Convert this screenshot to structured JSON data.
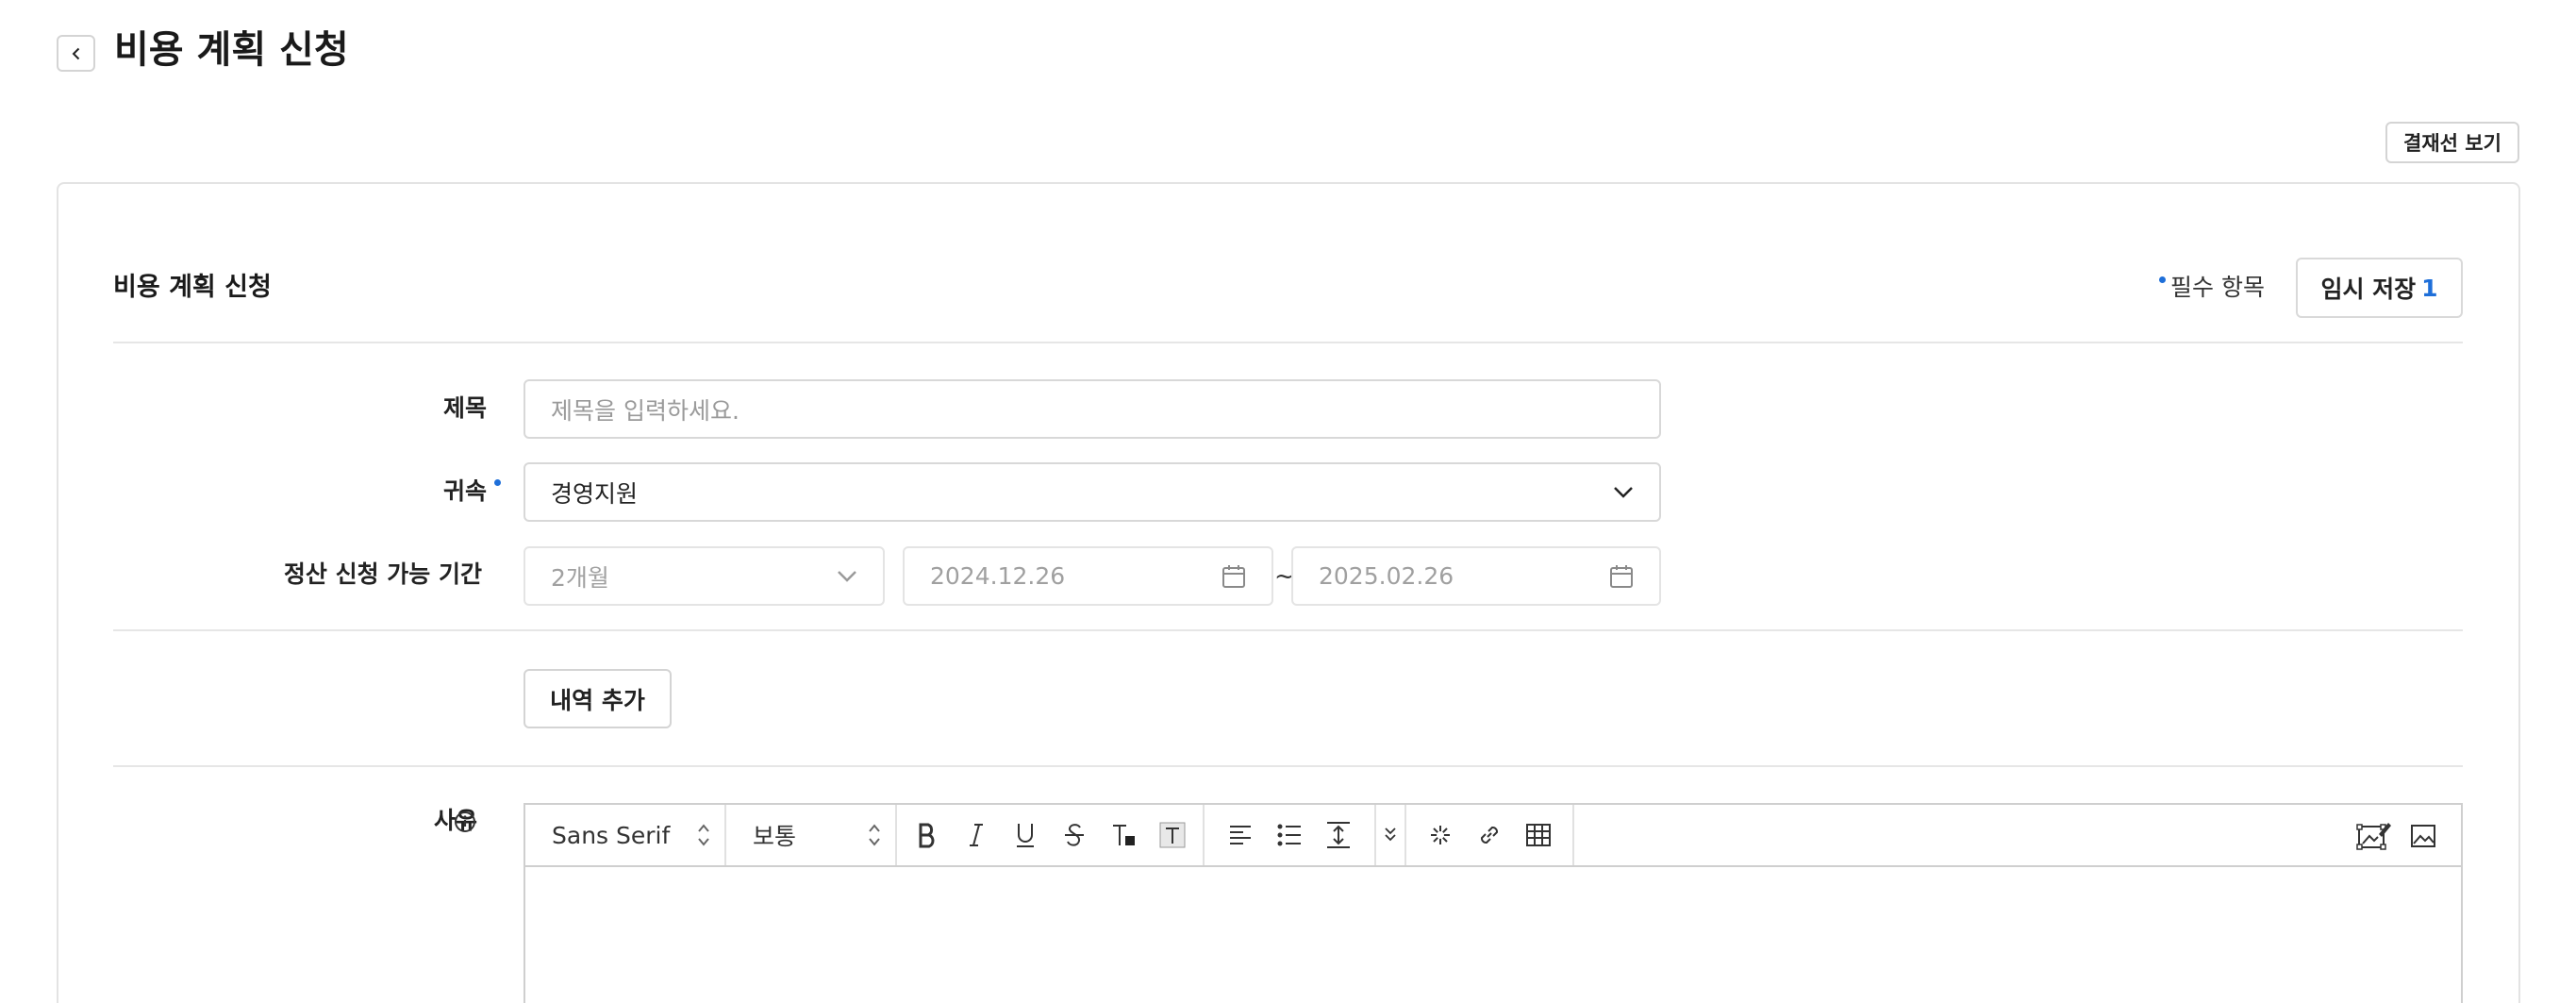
{
  "header": {
    "title": "비용 계획 신청"
  },
  "approval_line_button": "결재선 보기",
  "form": {
    "section_title": "비용 계획 신청",
    "required_note": "필수 항목",
    "save_draft": {
      "label": "임시 저장",
      "count": "1"
    },
    "fields": {
      "title": {
        "label": "제목",
        "placeholder": "제목을 입력하세요."
      },
      "department": {
        "label": "귀속",
        "value": "경영지원"
      },
      "settlement_period": {
        "label": "정산 신청 가능 기간",
        "duration": "2개월",
        "start_date": "2024.12.26",
        "separator": "~",
        "end_date": "2025.02.26"
      }
    },
    "add_item_button": "내역 추가",
    "reason": {
      "label": "사유",
      "toolbar": {
        "font_family": "Sans Serif",
        "font_size": "보통"
      }
    }
  },
  "colors": {
    "accent": "#1e6fd9",
    "border": "#d8d8d8",
    "text": "#222222",
    "placeholder": "#9a9a9a"
  }
}
